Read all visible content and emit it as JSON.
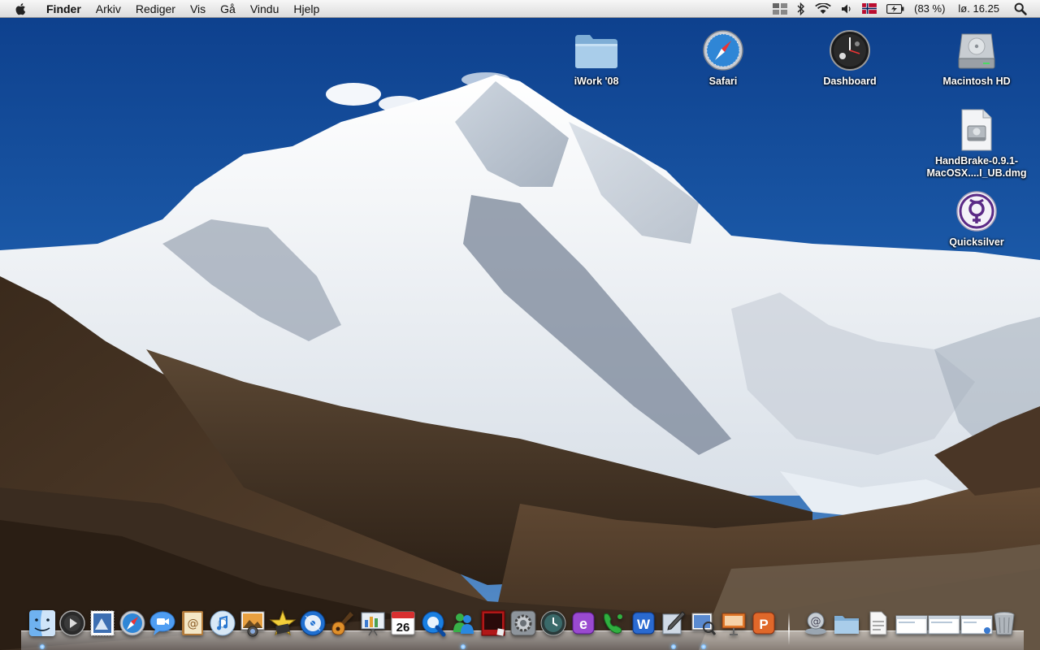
{
  "menubar": {
    "app_name": "Finder",
    "menus": [
      "Arkiv",
      "Rediger",
      "Vis",
      "Gå",
      "Vindu",
      "Hjelp"
    ],
    "battery_percent": "(83 %)",
    "clock": "lø. 16.25",
    "status_icons": [
      "spaces-icon",
      "bluetooth-icon",
      "wifi-icon",
      "volume-icon",
      "flag-norway-icon",
      "battery-icon",
      "spotlight-icon"
    ]
  },
  "desktop": {
    "icons": [
      {
        "label": "iWork '08",
        "icon": "folder-icon"
      },
      {
        "label": "Safari",
        "icon": "safari-icon"
      },
      {
        "label": "Dashboard",
        "icon": "dashboard-icon"
      },
      {
        "label": "Macintosh HD",
        "icon": "hard-drive-icon"
      },
      {
        "label": "HandBrake-0.9.1-MacOSX....I_UB.dmg",
        "icon": "disk-image-icon"
      },
      {
        "label": "Quicksilver",
        "icon": "quicksilver-icon"
      }
    ]
  },
  "dock": {
    "apps": [
      {
        "name": "finder",
        "running": true
      },
      {
        "name": "front-row",
        "running": false
      },
      {
        "name": "mail-stamp",
        "running": false
      },
      {
        "name": "safari",
        "running": false
      },
      {
        "name": "ichat",
        "running": false
      },
      {
        "name": "address-book",
        "running": false
      },
      {
        "name": "itunes",
        "running": false
      },
      {
        "name": "iphoto",
        "running": false
      },
      {
        "name": "imovie",
        "running": false
      },
      {
        "name": "idvd",
        "running": false
      },
      {
        "name": "garageband",
        "running": false
      },
      {
        "name": "keynote",
        "running": false
      },
      {
        "name": "ical",
        "running": false
      },
      {
        "name": "quicktime",
        "running": false
      },
      {
        "name": "messenger",
        "running": true
      },
      {
        "name": "photo-booth",
        "running": false
      },
      {
        "name": "system-preferences",
        "running": false
      },
      {
        "name": "time-machine",
        "running": false
      },
      {
        "name": "entourage",
        "running": false
      },
      {
        "name": "phone",
        "running": false
      },
      {
        "name": "word",
        "running": false
      },
      {
        "name": "script-editor",
        "running": true
      },
      {
        "name": "preview",
        "running": true
      },
      {
        "name": "presentation",
        "running": false
      },
      {
        "name": "powerpoint",
        "running": false
      }
    ],
    "calendar_day": "26",
    "stacks": [
      "downloads-stack",
      "documents-folder",
      "file-stack",
      "window-1",
      "window-2",
      "window-3",
      "trash"
    ]
  },
  "colors": {
    "sky": "#1e5aa8",
    "snow": "#f2f5f8",
    "rock": "#4a3a2a",
    "label": "#ffffff"
  }
}
